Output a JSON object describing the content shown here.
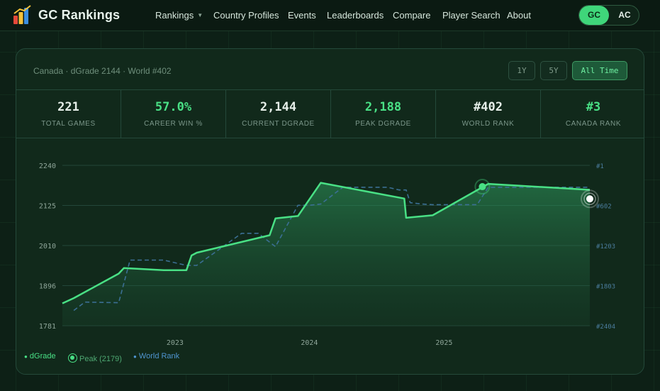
{
  "header": {
    "brand": "GC Rankings",
    "nav": [
      "Rankings",
      "Country Profiles",
      "Events",
      "Leaderboards",
      "Compare",
      "Player Search",
      "About"
    ],
    "toggle": {
      "gc": "GC",
      "ac": "AC",
      "active": "GC"
    }
  },
  "card": {
    "subtitle": "Canada · dGrade 2144 · World #402",
    "ranges": [
      "1Y",
      "5Y",
      "All Time"
    ],
    "active_range": "All Time"
  },
  "stats": [
    {
      "value": "221",
      "label": "TOTAL GAMES",
      "highlight": false
    },
    {
      "value": "57.0%",
      "label": "CAREER WIN %",
      "highlight": true
    },
    {
      "value": "2,144",
      "label": "CURRENT DGRADE",
      "highlight": false
    },
    {
      "value": "2,188",
      "label": "PEAK DGRADE",
      "highlight": true
    },
    {
      "value": "#402",
      "label": "WORLD RANK",
      "highlight": false
    },
    {
      "value": "#3",
      "label": "CANADA RANK",
      "highlight": true
    }
  ],
  "legend": {
    "dgrade": "dGrade",
    "peak": "Peak (2179)",
    "world_rank": "World Rank"
  },
  "colors": {
    "accent": "#49e085",
    "rank": "#3b6f94",
    "bg": "#0d2016"
  },
  "chart_data": {
    "type": "line",
    "x_ticks": [
      "2023",
      "2024",
      "2025"
    ],
    "y_left_ticks": [
      "2240",
      "2125",
      "2010",
      "1896",
      "1781"
    ],
    "y_right_ticks": [
      "#1",
      "#602",
      "#1203",
      "#1803",
      "#2404"
    ],
    "ylim": [
      1781,
      2240
    ],
    "rank_lim": [
      1,
      2404
    ],
    "series": [
      {
        "name": "dGrade",
        "x": [
          "2022-03-01",
          "2022-04-01",
          "2022-08-01",
          "2022-08-15",
          "2022-12-01",
          "2023-02-01",
          "2023-02-15",
          "2023-03-01",
          "2023-09-15",
          "2023-10-01",
          "2023-12-01",
          "2024-02-01",
          "2024-09-15",
          "2024-09-20",
          "2024-12-01",
          "2025-05-01",
          "2026-02-01"
        ],
        "values": [
          1845,
          1860,
          1930,
          1946,
          1940,
          1940,
          1982,
          1990,
          2040,
          2088,
          2095,
          2190,
          2145,
          2090,
          2097,
          2187,
          2170
        ]
      },
      {
        "name": "World Rank",
        "x": [
          "2022-04-01",
          "2022-05-01",
          "2022-08-01",
          "2022-09-01",
          "2022-10-01",
          "2022-12-01",
          "2023-02-01",
          "2023-03-01",
          "2023-07-01",
          "2023-08-01",
          "2023-08-15",
          "2023-10-01",
          "2023-12-01",
          "2024-01-01",
          "2024-02-01",
          "2024-04-01",
          "2024-08-01",
          "2024-09-01",
          "2024-09-20",
          "2024-10-01",
          "2024-11-01",
          "2024-12-01",
          "2025-04-01",
          "2025-05-01",
          "2026-02-01"
        ],
        "values": [
          2175,
          2050,
          2060,
          1420,
          1420,
          1420,
          1500,
          1500,
          1020,
          1020,
          1020,
          1220,
          600,
          600,
          580,
          330,
          330,
          370,
          370,
          560,
          580,
          590,
          590,
          330,
          330
        ]
      }
    ],
    "peak": {
      "x": "2025-04-15",
      "value": 2179,
      "label": "Peak (2179)"
    },
    "current": {
      "x": "2026-02-01",
      "value": 2144
    }
  }
}
